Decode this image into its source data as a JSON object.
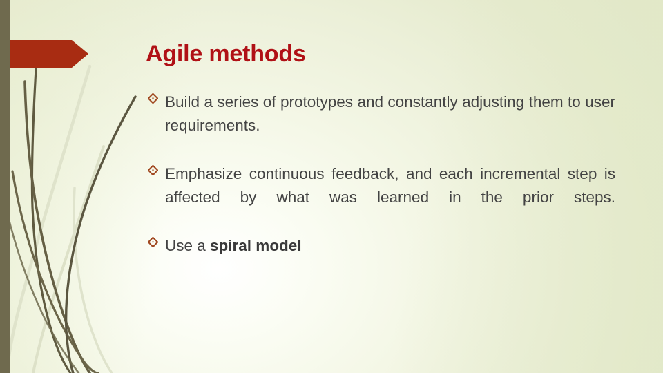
{
  "slide": {
    "title": "Agile methods",
    "bullet_marker": "diamond-bullet",
    "bullets": [
      {
        "id": "bullet-prototypes",
        "text": "Build a series of prototypes and constantly adjusting them to user requirements.",
        "bold_tail": "",
        "justified": true
      },
      {
        "id": "bullet-feedback",
        "text": "Emphasize continuous feedback, and each incremental step is affected by what was learned in the prior steps.",
        "bold_tail": "",
        "justified": true
      },
      {
        "id": "bullet-spiral-model",
        "text": "Use a ",
        "bold_tail": "spiral model",
        "justified": false
      }
    ]
  },
  "theme": {
    "title_color": "#b01116",
    "body_text_color": "#434343",
    "bullet_color": "#a0471f",
    "accent_banner_color": "#a82c12",
    "left_bar_color": "#6f6a4e",
    "background_edge_color": "#e3e9cc",
    "background_center_color": "#ffffff",
    "grass_dark_color": "#5f5a40",
    "grass_light_color": "#d9ddc4"
  },
  "decor": {
    "arrow_banner": "right-pointing-arrow-banner",
    "left_bar": "vertical-accent-bar",
    "grass_motif": "curved-grass-blades"
  }
}
